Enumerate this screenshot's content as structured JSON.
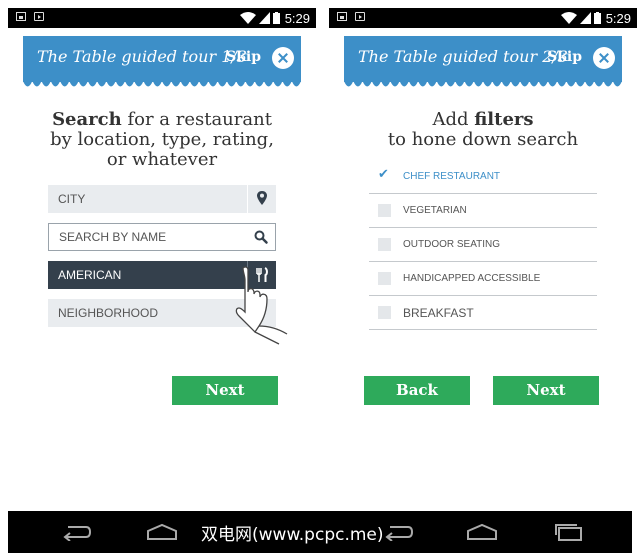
{
  "status_bar": {
    "time": "5:29"
  },
  "screen1": {
    "banner": {
      "title": "The Table guided tour 1/3",
      "skip": "Skip"
    },
    "heading": {
      "bold": "Search",
      "line1_rest": " for a restaurant",
      "line2": "by location, type, rating,",
      "line3": "or whatever"
    },
    "fields": [
      {
        "label": "CITY",
        "icon": "location-pin-icon"
      },
      {
        "label": "SEARCH BY NAME",
        "icon": "search-icon"
      },
      {
        "label": "AMERICAN",
        "icon": "fork-knife-icon"
      },
      {
        "label": "NEIGHBORHOOD"
      }
    ],
    "next": "Next"
  },
  "screen2": {
    "banner": {
      "title": "The Table guided tour 2/3",
      "skip": "Skip"
    },
    "heading": {
      "line1_pre": "Add ",
      "line1_bold": "filters",
      "line2": "to hone down search"
    },
    "filters": [
      {
        "label": "CHEF RESTAURANT",
        "checked": true
      },
      {
        "label": "VEGETARIAN",
        "checked": false
      },
      {
        "label": "OUTDOOR SEATING",
        "checked": false
      },
      {
        "label": "HANDICAPPED ACCESSIBLE",
        "checked": false
      },
      {
        "label": "BREAKFAST",
        "checked": false
      }
    ],
    "back": "Back",
    "next": "Next"
  },
  "watermark": "双电网(www.pcpc.me)",
  "colors": {
    "banner_blue": "#3d8fc8",
    "button_green": "#2eaa5b",
    "dark_field": "#34404c",
    "light_field": "#e9ecef"
  }
}
